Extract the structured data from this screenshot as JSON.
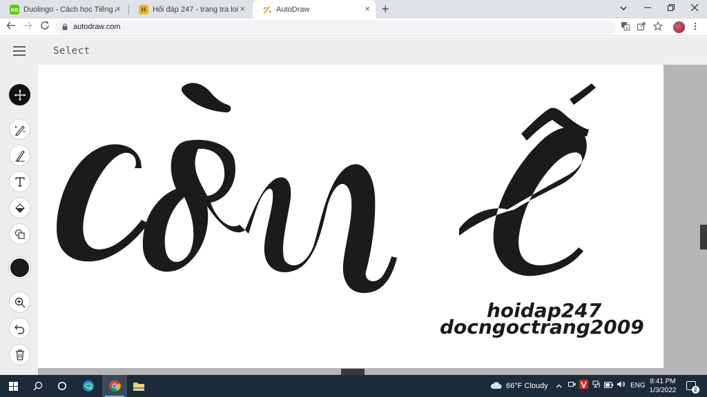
{
  "browser": {
    "tabs": [
      {
        "title": "Duolingo - Cách học Tiếng Anh t",
        "favicon": "duolingo-owl-icon",
        "favicon_color": "#58cc02"
      },
      {
        "title": "Hỏi đáp 247 - trang tra loi",
        "favicon": "hoidap247-logo-icon",
        "favicon_color": "#f5b800"
      },
      {
        "title": "AutoDraw",
        "favicon": "autodraw-pencil-icon",
        "favicon_color": "#ffffff"
      }
    ],
    "active_tab": 2,
    "url": "autodraw.com",
    "new_tab_symbol": "+",
    "close_symbol": "×"
  },
  "app": {
    "mode_label": "Select",
    "tools": [
      {
        "name": "select-move",
        "icon": "move-arrows-icon",
        "selected": true
      },
      {
        "name": "autodraw",
        "icon": "autodraw-sparkle-pencil-icon"
      },
      {
        "name": "draw",
        "icon": "pencil-icon"
      },
      {
        "name": "type",
        "icon": "text-t-icon"
      },
      {
        "name": "fill",
        "icon": "paint-bucket-icon"
      },
      {
        "name": "shape",
        "icon": "shapes-icon"
      },
      {
        "name": "color",
        "icon": "color-swatch",
        "value": "#1b1b1b"
      },
      {
        "name": "zoom",
        "icon": "zoom-in-icon"
      },
      {
        "name": "undo",
        "icon": "undo-icon"
      },
      {
        "name": "delete",
        "icon": "trash-icon"
      }
    ],
    "canvas": {
      "ink_color": "#1b1b1b",
      "watermark_line1": "hoidap247",
      "watermark_line2": "docngoctrang2009"
    }
  },
  "taskbar": {
    "weather": "66°F  Cloudy",
    "language": "ENG",
    "time": "8:41 PM",
    "date": "1/3/2022",
    "notification_count": "2",
    "apps": [
      "windows-start-icon",
      "search-icon",
      "cortana-icon",
      "edge-icon",
      "chrome-icon",
      "file-explorer-icon"
    ]
  }
}
